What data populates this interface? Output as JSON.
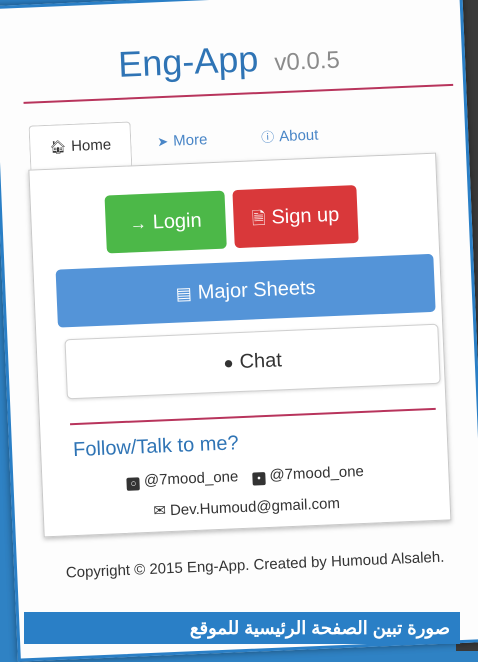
{
  "app": {
    "name": "Eng-App",
    "version": "v0.0.5"
  },
  "tabs": [
    {
      "label": "Home",
      "icon": "home-icon"
    },
    {
      "label": "More",
      "icon": "rocket-icon"
    },
    {
      "label": "About",
      "icon": "info-icon"
    }
  ],
  "buttons": {
    "login": "Login",
    "signup": "Sign up",
    "major": "Major Sheets",
    "chat": "Chat"
  },
  "follow": {
    "heading": "Follow/Talk to me?",
    "instagram": "@7mood_one",
    "twitter": "@7mood_one",
    "email": "Dev.Humoud@gmail.com"
  },
  "footer": {
    "copyright": "Copyright © 2015 Eng-App. Created by Humoud Alsaleh."
  },
  "caption": "صورة تبين الصفحة الرئيسية للموقع",
  "colors": {
    "brand_blue": "#2f74b5",
    "login_green": "#4cb848",
    "signup_red": "#d9383a",
    "major_blue": "#5494d8",
    "rule_red": "#b8345c",
    "frame_blue": "#2a7fc6"
  }
}
